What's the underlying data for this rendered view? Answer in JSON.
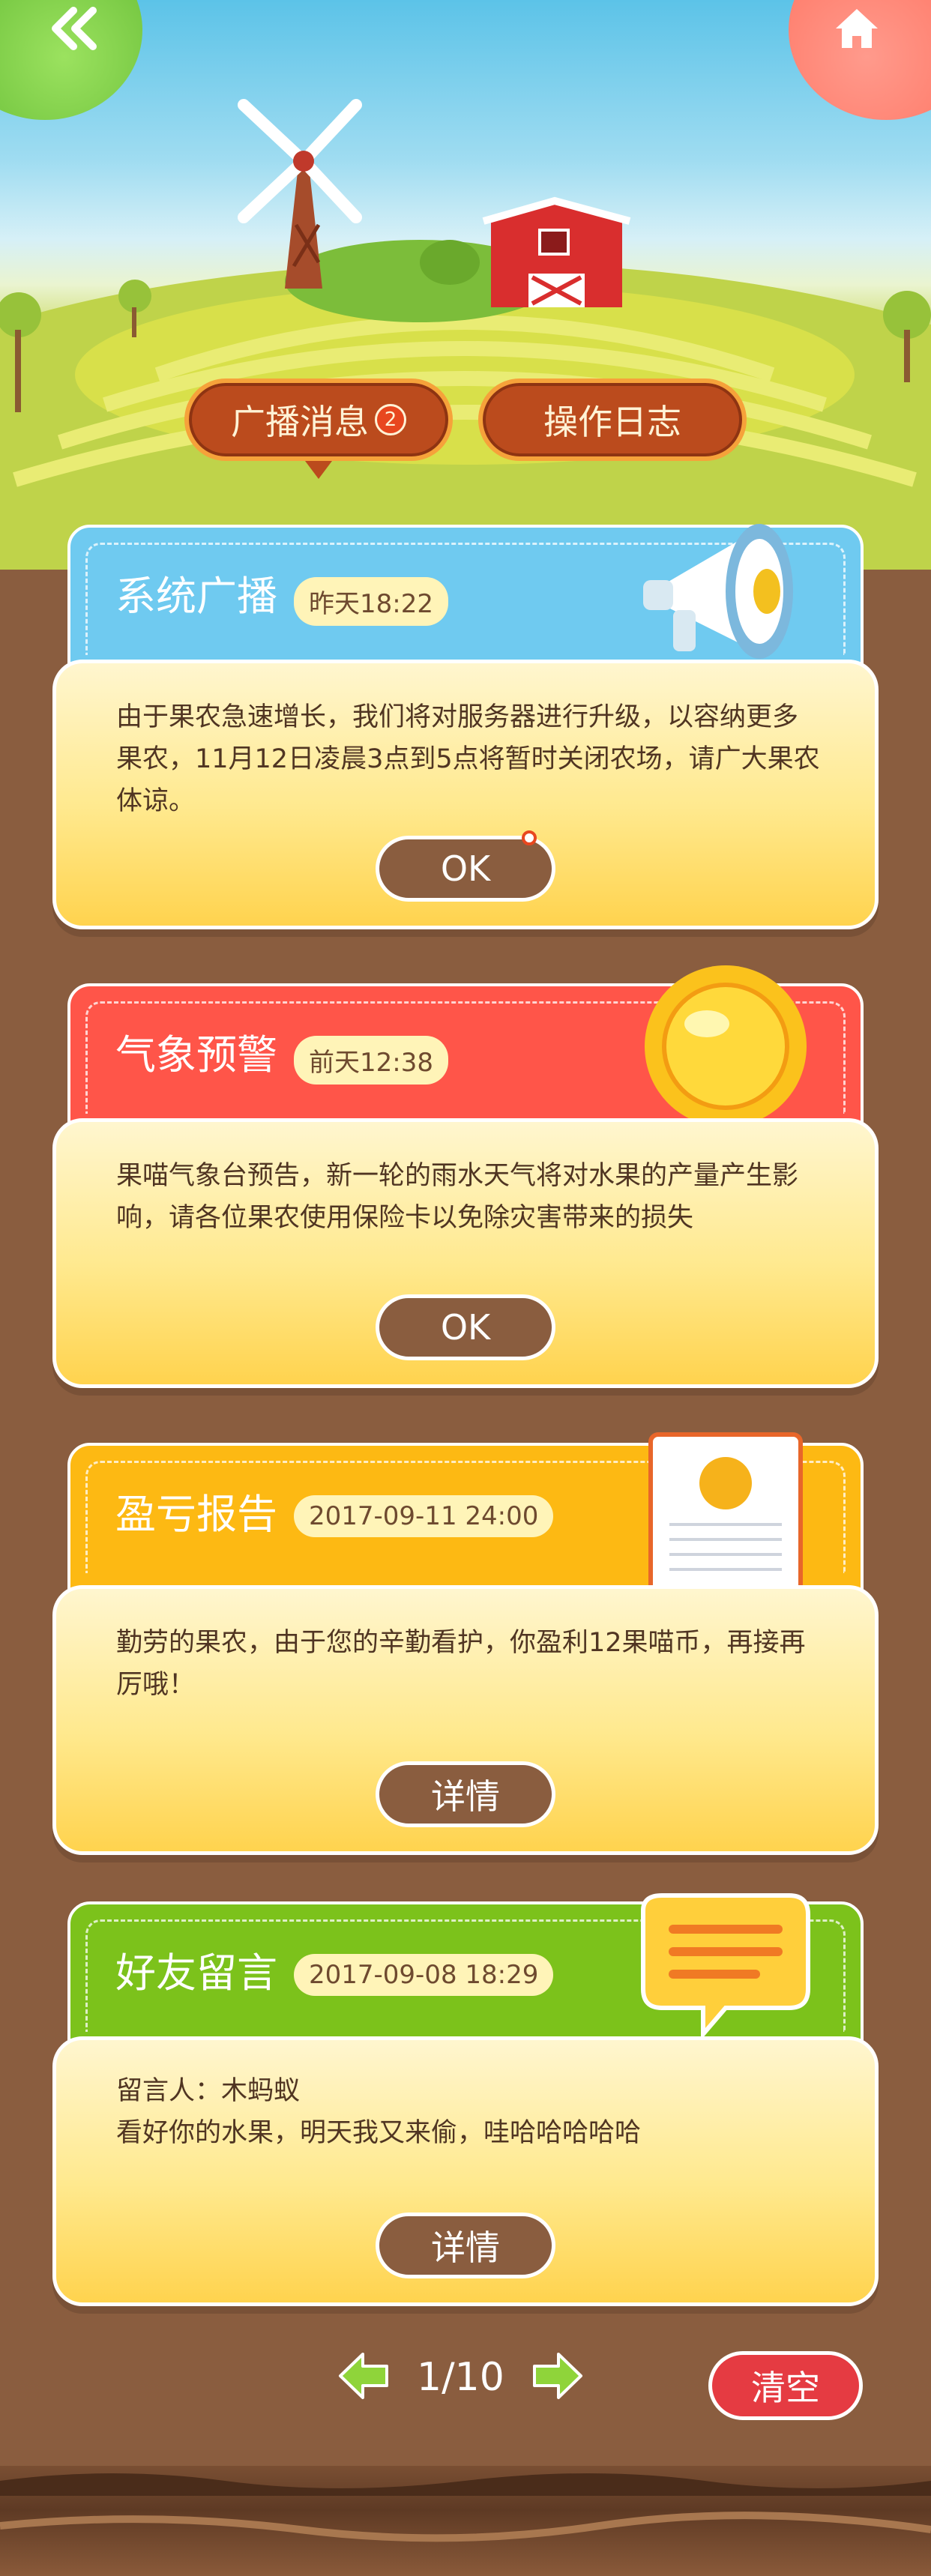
{
  "nav": {
    "back_icon": "double-chevron-left-icon",
    "home_icon": "home-icon"
  },
  "tabs": [
    {
      "label": "广播消息",
      "badge": "2"
    },
    {
      "label": "操作日志"
    }
  ],
  "cards": [
    {
      "title": "系统广播",
      "time": "昨天18:22",
      "text": "由于果农急速增长，我们将对服务器进行升级，以容纳更多果农，11月12日凌晨3点到5点将暂时关闭农场，请广大果农体谅。",
      "button": "OK",
      "color": "#6fcaf0",
      "icon": "megaphone-icon"
    },
    {
      "title": "气象预警",
      "time": "前天12:38",
      "text": "果喵气象台预告，新一轮的雨水天气将对水果的产量产生影响，请各位果农使用保险卡以免除灾害带来的损失",
      "button": "OK",
      "color": "#ff5549",
      "icon": "sun-icon"
    },
    {
      "title": "盈亏报告",
      "time": "2017-09-11 24:00",
      "text": "勤劳的果农，由于您的辛勤看护，你盈利12果喵币，再接再厉哦！",
      "button": "详情",
      "color": "#fdb913",
      "icon": "report-icon"
    },
    {
      "title": "好友留言",
      "time": "2017-09-08 18:29",
      "author_line": "留言人：木蚂蚁",
      "text": "看好你的水果，明天我又来偷，哇哈哈哈哈哈",
      "button": "详情",
      "color": "#7cc21b",
      "icon": "speech-bubble-icon"
    }
  ],
  "pager": {
    "current": "1/10",
    "prev_icon": "arrow-left-icon",
    "next_icon": "arrow-right-icon"
  },
  "clear_label": "清空"
}
